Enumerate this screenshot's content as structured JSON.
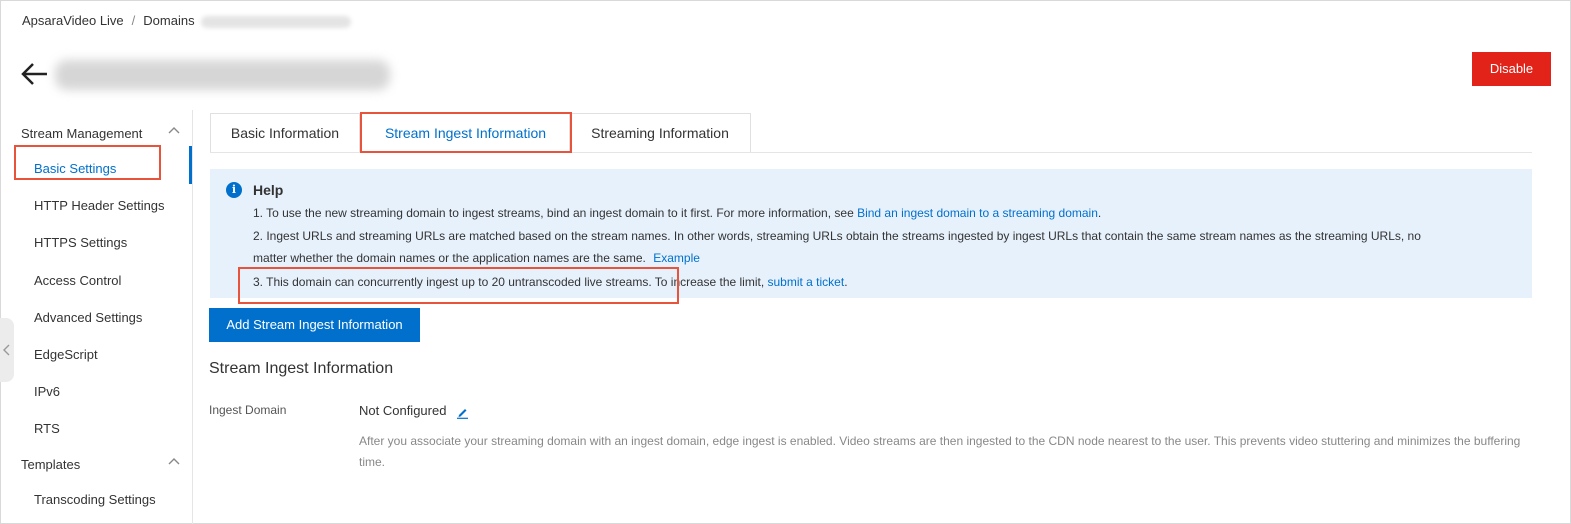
{
  "breadcrumb": {
    "items": [
      "ApsaraVideo Live",
      "Domains"
    ]
  },
  "header": {
    "disable_label": "Disable"
  },
  "sidebar": {
    "groups": [
      {
        "title": "Stream Management",
        "items": [
          "Basic Settings",
          "HTTP Header Settings",
          "HTTPS Settings",
          "Access Control",
          "Advanced Settings",
          "EdgeScript",
          "IPv6",
          "RTS"
        ]
      },
      {
        "title": "Templates",
        "items": [
          "Transcoding Settings"
        ]
      }
    ],
    "active_item": "Basic Settings"
  },
  "tabs": [
    {
      "label": "Basic Information",
      "active": false
    },
    {
      "label": "Stream Ingest Information",
      "active": true
    },
    {
      "label": "Streaming Information",
      "active": false
    }
  ],
  "help": {
    "title": "Help",
    "line1": "1. To use the new streaming domain to ingest streams, bind an ingest domain to it first. For more information, see ",
    "line1_link": "Bind an ingest domain to a streaming domain",
    "line1_end": ".",
    "line2a": "2. Ingest URLs and streaming URLs are matched based on the stream names. In other words, streaming URLs obtain the streams ingested by ingest URLs that contain the same stream names as the streaming URLs, no",
    "line2b": "matter whether the domain names or the application names are the same.",
    "line2_link": "Example",
    "line3": "3. This domain can concurrently ingest up to 20 untranscoded live streams.",
    "line3_rest": " To increase the limit, ",
    "line3_link": "submit a ticket",
    "line3_end": "."
  },
  "actions": {
    "add_label": "Add Stream Ingest Information"
  },
  "section": {
    "title": "Stream Ingest Information",
    "ingest_domain_label": "Ingest Domain",
    "ingest_domain_value": "Not Configured",
    "description": "After you associate your streaming domain with an ingest domain, edge ingest is enabled. Video streams are then ingested to the CDN node nearest to the user. This prevents video stuttering and minimizes the buffering time."
  },
  "colors": {
    "primary": "#0070cc",
    "danger": "#e2231a",
    "highlight": "#e8533c",
    "help_bg": "#e7f1fc"
  },
  "icons": [
    "back-arrow-icon",
    "chevron-up-icon",
    "info-icon",
    "edit-icon",
    "chevron-left-icon"
  ]
}
